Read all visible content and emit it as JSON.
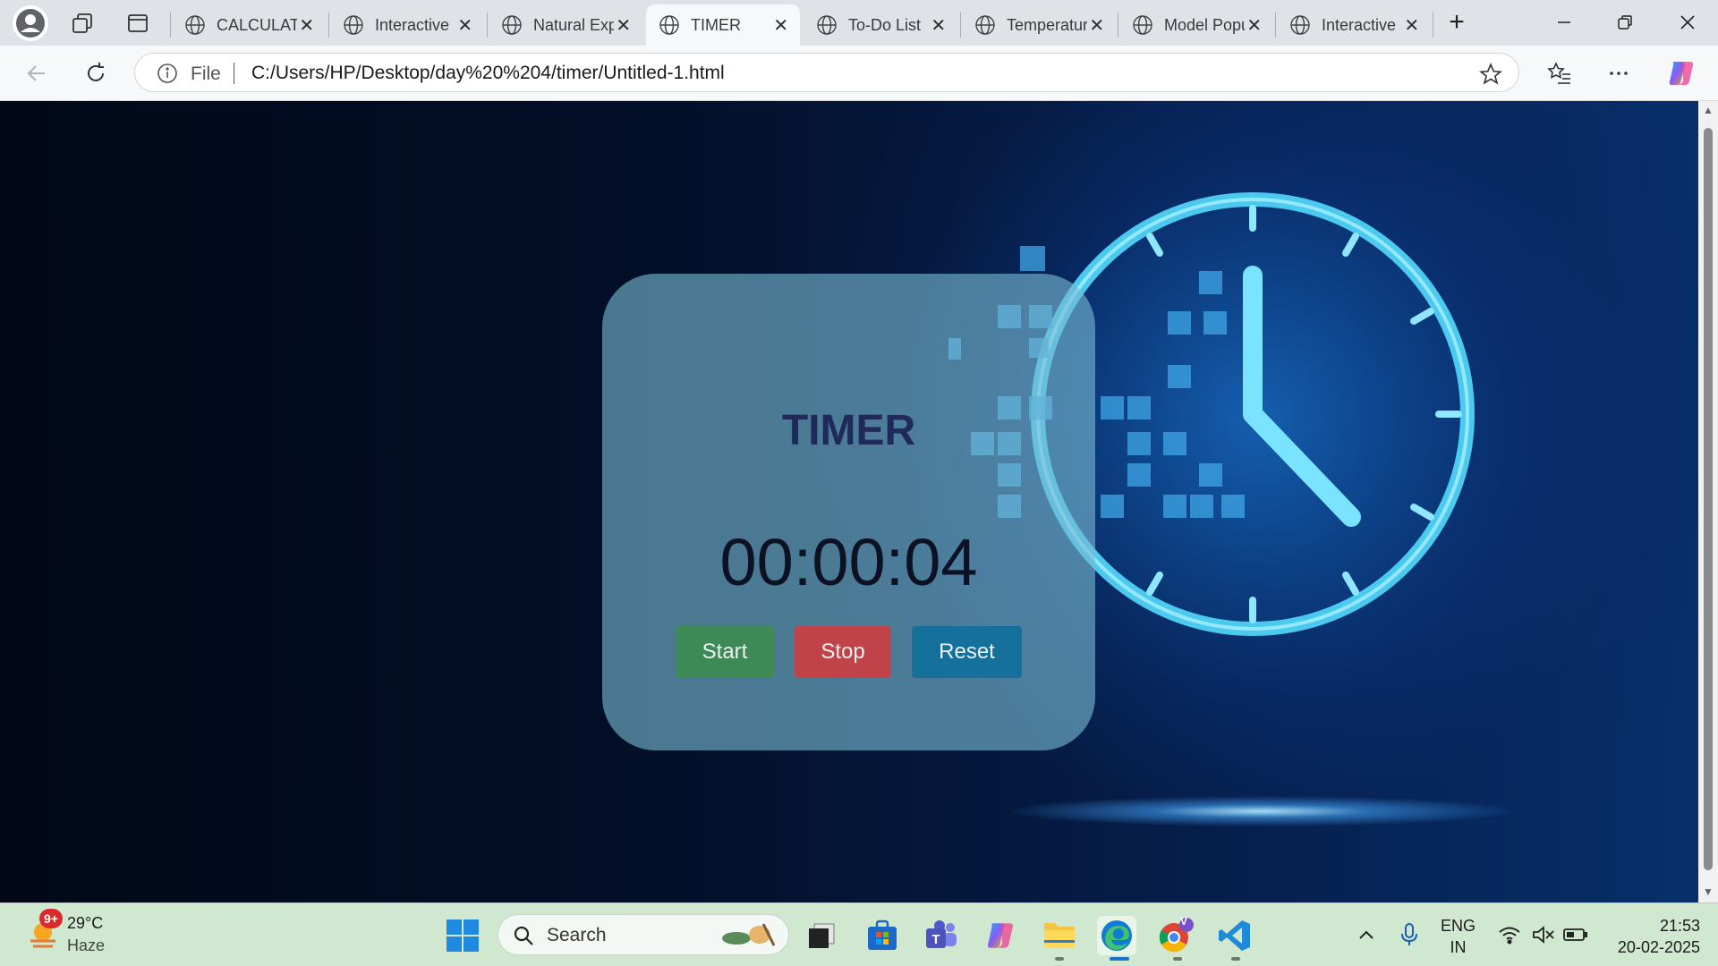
{
  "browser": {
    "tabs": [
      {
        "label": "CALCULATOR",
        "active": false
      },
      {
        "label": "Interactive",
        "active": false
      },
      {
        "label": "Natural Expressions",
        "active": false
      },
      {
        "label": "TIMER",
        "active": true
      },
      {
        "label": "To-Do List",
        "active": false
      },
      {
        "label": "Temperature",
        "active": false
      },
      {
        "label": "Model Popup",
        "active": false
      },
      {
        "label": "Interactive",
        "active": false
      }
    ],
    "address": {
      "scheme_label": "File",
      "url": "C:/Users/HP/Desktop/day%20%204/timer/Untitled-1.html"
    }
  },
  "page": {
    "title": "TIMER",
    "display": "00:00:04",
    "buttons": {
      "start": "Start",
      "stop": "Stop",
      "reset": "Reset"
    },
    "colors": {
      "start": "#3d8a57",
      "stop": "#c0434a",
      "reset": "#16709c",
      "title": "#1f2a5a"
    }
  },
  "taskbar": {
    "weather": {
      "temp": "29°C",
      "condition": "Haze",
      "badge": "9+"
    },
    "search_placeholder": "Search",
    "language": {
      "line1": "ENG",
      "line2": "IN"
    },
    "clock": {
      "time": "21:53",
      "date": "20-02-2025"
    },
    "apps": [
      "task-view",
      "microsoft-store",
      "teams",
      "copilot",
      "file-explorer",
      "edge",
      "chrome",
      "vscode"
    ],
    "chrome_badge": "V"
  }
}
